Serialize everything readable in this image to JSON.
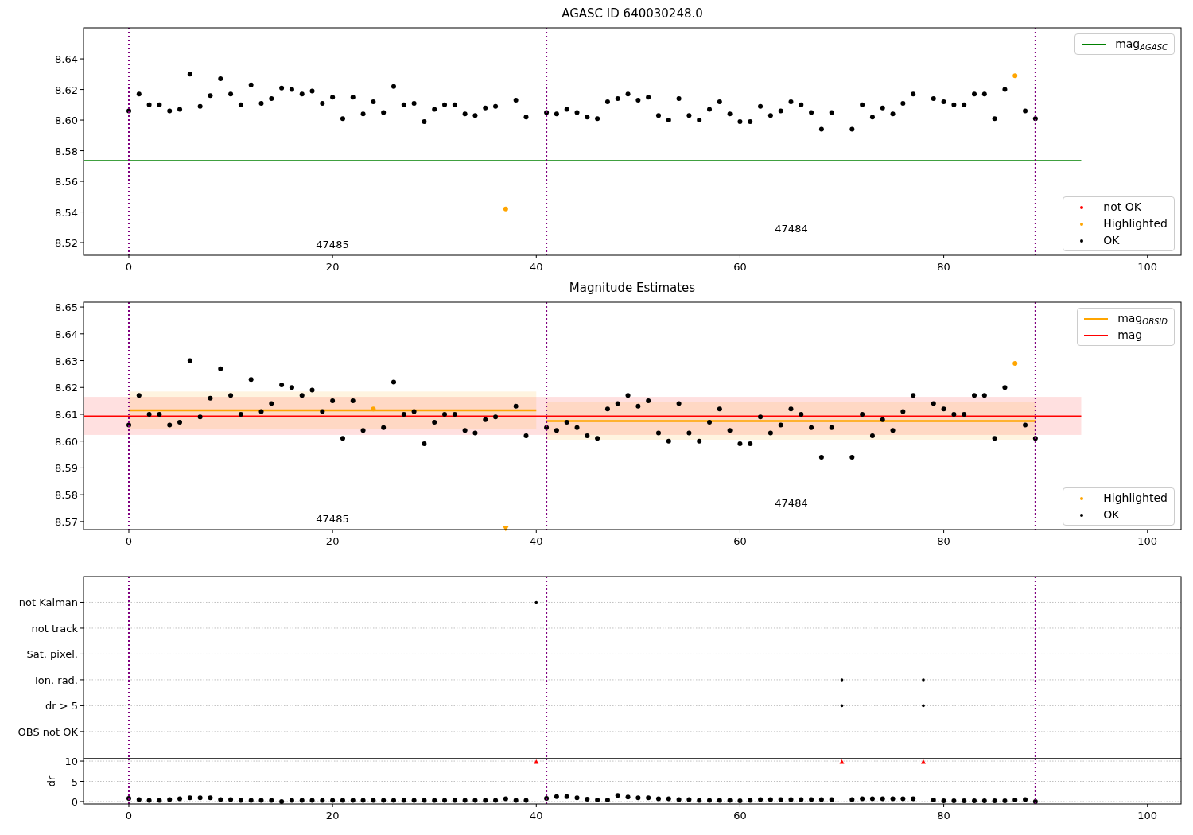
{
  "figure": {
    "panels": [
      {
        "chart_data": {
          "type": "scatter",
          "title": "AGASC ID 640030248.0",
          "xlim": [
            -4.45,
            103.3
          ],
          "ylim": [
            8.5117,
            8.6603
          ],
          "xticks": [
            0,
            20,
            40,
            60,
            80,
            100
          ],
          "yticks": [
            8.52,
            8.54,
            8.56,
            8.58,
            {
              "value": 8.6,
              "label": "8.60"
            },
            8.62,
            8.64
          ],
          "series": [
            {
              "name": "mag$_{AGASC}$",
              "type": "line",
              "color": "#008000",
              "x": [
                -4.45,
                93.5
              ],
              "values": [
                8.5735,
                8.5735
              ]
            },
            {
              "name": "not OK",
              "color": "#ff0000"
            },
            {
              "name": "Highlighted",
              "color": "#ffa500",
              "x": [
                37,
                87
              ],
              "values": [
                8.542,
                8.629
              ]
            },
            {
              "name": "OK",
              "color": "#000000",
              "x": [
                0,
                1,
                2,
                3,
                4,
                5,
                6,
                7,
                8,
                9,
                10,
                11,
                12,
                13,
                14,
                15,
                16,
                17,
                18,
                19,
                20,
                21,
                22,
                23,
                24,
                25,
                26,
                27,
                28,
                29,
                30,
                31,
                32,
                33,
                34,
                35,
                36,
                37,
                38,
                39,
                40,
                41,
                42,
                43,
                44,
                45,
                46,
                47,
                48,
                49,
                50,
                51,
                52,
                53,
                54,
                55,
                56,
                57,
                58,
                59,
                60,
                61,
                62,
                63,
                64,
                65,
                66,
                67,
                68,
                69,
                70,
                71,
                72,
                73,
                74,
                75,
                76,
                77,
                78,
                79,
                80,
                81,
                82,
                83,
                84,
                85,
                86,
                87,
                88,
                89
              ],
              "values": [
                8.606,
                8.617,
                8.61,
                8.61,
                8.606,
                8.607,
                8.63,
                8.609,
                8.616,
                8.627,
                8.617,
                8.61,
                8.623,
                8.611,
                8.614,
                8.621,
                8.62,
                8.617,
                8.619,
                8.611,
                8.615,
                8.601,
                8.615,
                8.604,
                8.612,
                8.605,
                8.622,
                8.61,
                8.611,
                8.599,
                8.607,
                8.61,
                8.61,
                8.604,
                8.603,
                8.608,
                8.609,
                null,
                8.613,
                8.602,
                null,
                8.605,
                8.604,
                8.607,
                8.605,
                8.602,
                8.601,
                8.612,
                8.614,
                8.617,
                8.613,
                8.615,
                8.603,
                8.6,
                8.614,
                8.603,
                8.6,
                8.607,
                8.612,
                8.604,
                8.599,
                8.599,
                8.609,
                8.603,
                8.606,
                8.612,
                8.61,
                8.605,
                8.594,
                8.605,
                null,
                8.594,
                8.61,
                8.602,
                8.608,
                8.604,
                8.611,
                8.617,
                null,
                8.614,
                8.612,
                8.61,
                8.61,
                8.617,
                8.617,
                8.601,
                8.62,
                null,
                8.606,
                8.601
              ]
            }
          ],
          "ref_lines": [
            {
              "axis": "x",
              "value": 0,
              "color": "#800080"
            },
            {
              "axis": "x",
              "value": 41,
              "color": "#800080"
            },
            {
              "axis": "x",
              "value": 89,
              "color": "#800080"
            }
          ],
          "annotations": [
            "47485",
            "47484"
          ]
        }
      },
      {
        "chart_data": {
          "type": "scatter",
          "title": "Magnitude Estimates",
          "xlim": [
            -4.45,
            103.3
          ],
          "ylim": [
            8.567,
            8.6518
          ],
          "xticks": [
            0,
            20,
            40,
            60,
            80,
            100
          ],
          "yticks": [
            8.57,
            8.58,
            8.59,
            {
              "value": 8.6,
              "label": "8.60"
            },
            8.61,
            8.62,
            8.63,
            8.64,
            8.65
          ],
          "series": [
            {
              "name": "mag$_{OBSID}$",
              "type": "line",
              "color": "#ffa500",
              "x": [
                0,
                40,
                40.5,
                41,
                89
              ],
              "values": [
                8.6115,
                8.6115,
                null,
                8.6075,
                8.6075
              ]
            },
            {
              "name": "mag",
              "type": "line",
              "color": "#ff0000",
              "x": [
                -4.45,
                93.5
              ],
              "values": [
                8.6093,
                8.6093
              ]
            },
            {
              "name": "Highlighted",
              "color": "#ffa500",
              "x": [
                24,
                87
              ],
              "values": [
                8.612,
                8.629
              ]
            },
            {
              "name": "OK",
              "color": "#000000",
              "x": [
                0,
                1,
                2,
                3,
                4,
                5,
                6,
                7,
                8,
                9,
                10,
                11,
                12,
                13,
                14,
                15,
                16,
                17,
                18,
                19,
                20,
                21,
                22,
                23,
                24,
                25,
                26,
                27,
                28,
                29,
                30,
                31,
                32,
                33,
                34,
                35,
                36,
                37,
                38,
                39,
                40,
                41,
                42,
                43,
                44,
                45,
                46,
                47,
                48,
                49,
                50,
                51,
                52,
                53,
                54,
                55,
                56,
                57,
                58,
                59,
                60,
                61,
                62,
                63,
                64,
                65,
                66,
                67,
                68,
                69,
                70,
                71,
                72,
                73,
                74,
                75,
                76,
                77,
                78,
                79,
                80,
                81,
                82,
                83,
                84,
                85,
                86,
                87,
                88,
                89
              ],
              "values": [
                8.606,
                8.617,
                8.61,
                8.61,
                8.606,
                8.607,
                8.63,
                8.609,
                8.616,
                8.627,
                8.617,
                8.61,
                8.623,
                8.611,
                8.614,
                8.621,
                8.62,
                8.617,
                8.619,
                8.611,
                8.615,
                8.601,
                8.615,
                8.604,
                null,
                8.605,
                8.622,
                8.61,
                8.611,
                8.599,
                8.607,
                8.61,
                8.61,
                8.604,
                8.603,
                8.608,
                8.609,
                null,
                8.613,
                8.602,
                null,
                8.605,
                8.604,
                8.607,
                8.605,
                8.602,
                8.601,
                8.612,
                8.614,
                8.617,
                8.613,
                8.615,
                8.603,
                8.6,
                8.614,
                8.603,
                8.6,
                8.607,
                8.612,
                8.604,
                8.599,
                8.599,
                8.609,
                8.603,
                8.606,
                8.612,
                8.61,
                8.605,
                8.594,
                8.605,
                null,
                8.594,
                8.61,
                8.602,
                8.608,
                8.604,
                8.611,
                8.617,
                null,
                8.614,
                8.612,
                8.61,
                8.61,
                8.617,
                8.617,
                8.601,
                8.62,
                null,
                8.606,
                8.601
              ]
            },
            {
              "marker": "triangle",
              "color": "#ffa500",
              "x": [
                37
              ],
              "values": [
                8.5675
              ]
            }
          ],
          "bands": [
            {
              "axis": "y",
              "from": 8.6023,
              "to": 8.6165,
              "color": "#ff0000"
            },
            {
              "axis": "y",
              "from": 8.6045,
              "to": 8.6185,
              "color": "#ffa500"
            },
            {
              "axis": "y",
              "from": 8.6005,
              "to": 8.6145,
              "color": "#ffa500"
            }
          ],
          "ref_lines": [
            {
              "axis": "x",
              "value": 0,
              "color": "#800080"
            },
            {
              "axis": "x",
              "value": 41,
              "color": "#800080"
            },
            {
              "axis": "x",
              "value": 89,
              "color": "#800080"
            }
          ],
          "annotations": [
            "47485",
            "47484"
          ]
        }
      },
      {
        "flag_rows": [
          "not Kalman",
          "not track",
          "Sat. pixel.",
          "Ion. rad.",
          "dr > 5",
          "OBS not OK"
        ]
      },
      {
        "chart_data": {
          "type": "scatter",
          "ylabel": "dr",
          "grid": true,
          "xlim": [
            -4.45,
            103.3
          ],
          "ylim": [
            -0.6,
            10.6
          ],
          "xticks": [
            0,
            20,
            40,
            60,
            80,
            100
          ],
          "yticks": [
            0,
            5,
            10
          ],
          "series": [
            {
              "color": "#000000",
              "x": [
                0,
                1,
                2,
                3,
                4,
                5,
                6,
                7,
                8,
                9,
                10,
                11,
                12,
                13,
                14,
                15,
                16,
                17,
                18,
                19,
                20,
                21,
                22,
                23,
                24,
                25,
                26,
                27,
                28,
                29,
                30,
                31,
                32,
                33,
                34,
                35,
                36,
                37,
                38,
                39,
                40,
                41,
                42,
                43,
                44,
                45,
                46,
                47,
                48,
                49,
                50,
                51,
                52,
                53,
                54,
                55,
                56,
                57,
                58,
                59,
                60,
                61,
                62,
                63,
                64,
                65,
                66,
                67,
                68,
                69,
                70,
                71,
                72,
                73,
                74,
                75,
                76,
                77,
                78,
                79,
                80,
                81,
                82,
                83,
                84,
                85,
                86,
                87,
                88,
                89
              ],
              "values": [
                0.8,
                0.5,
                0.3,
                0.3,
                0.5,
                0.7,
                0.9,
                0.9,
                0.9,
                0.5,
                0.5,
                0.3,
                0.3,
                0.3,
                0.3,
                0,
                0.3,
                0.3,
                0.3,
                0.3,
                0.3,
                0.3,
                0.3,
                0.3,
                0.3,
                0.3,
                0.3,
                0.3,
                0.3,
                0.3,
                0.3,
                0.3,
                0.3,
                0.3,
                0.3,
                0.3,
                0.3,
                0.7,
                0.3,
                0.3,
                null,
                0.8,
                1.2,
                1.2,
                0.9,
                0.6,
                0.4,
                0.4,
                1.5,
                1.1,
                0.9,
                0.9,
                0.7,
                0.7,
                0.5,
                0.5,
                0.3,
                0.3,
                0.3,
                0.3,
                0.2,
                0.3,
                0.5,
                0.5,
                0.5,
                0.5,
                0.5,
                0.5,
                0.5,
                0.5,
                null,
                0.5,
                0.7,
                0.7,
                0.7,
                0.7,
                0.7,
                0.7,
                null,
                0.4,
                0.2,
                0.2,
                0.2,
                0.2,
                0.2,
                0.2,
                0.2,
                0.4,
                0.5,
                0
              ]
            },
            {
              "marker": "triangle",
              "color": "#ff0000",
              "x": [
                40,
                70,
                78
              ],
              "values": [
                9.8,
                9.8,
                9.8
              ]
            }
          ],
          "ref_lines": [
            {
              "axis": "x",
              "value": 0,
              "color": "#800080"
            },
            {
              "axis": "x",
              "value": 41,
              "color": "#800080"
            },
            {
              "axis": "x",
              "value": 89,
              "color": "#800080"
            }
          ]
        }
      }
    ]
  }
}
